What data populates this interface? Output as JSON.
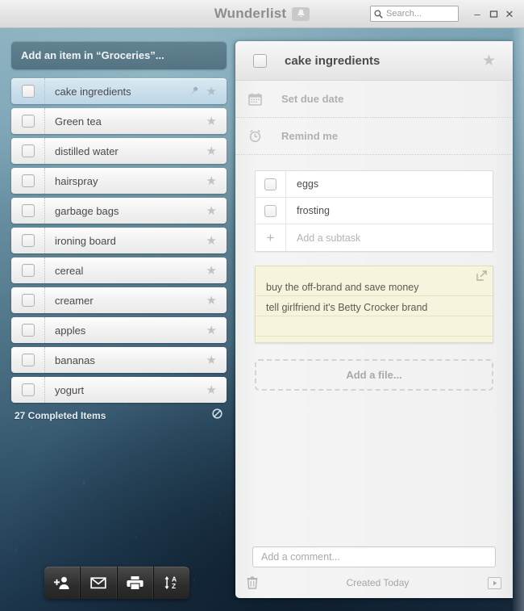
{
  "titlebar": {
    "app_title": "Wunderlist",
    "bell_icon": "bell-icon",
    "search": {
      "placeholder": "Search...",
      "value": "Search...",
      "icon": "search-icon"
    },
    "window_controls": {
      "minimize": "–",
      "maximize": "❐",
      "close": "✕"
    }
  },
  "list_panel": {
    "add_item_placeholder": "Add an item in “Groceries”...",
    "list_name": "Groceries",
    "tasks": [
      {
        "title": "cake ingredients",
        "selected": true,
        "starred": false,
        "pinned": true,
        "checked": false
      },
      {
        "title": "Green tea",
        "selected": false,
        "starred": false,
        "pinned": false,
        "checked": false
      },
      {
        "title": "distilled water",
        "selected": false,
        "starred": false,
        "pinned": false,
        "checked": false
      },
      {
        "title": "hairspray",
        "selected": false,
        "starred": false,
        "pinned": false,
        "checked": false
      },
      {
        "title": "garbage bags",
        "selected": false,
        "starred": false,
        "pinned": false,
        "checked": false
      },
      {
        "title": "ironing board",
        "selected": false,
        "starred": false,
        "pinned": false,
        "checked": false
      },
      {
        "title": "cereal",
        "selected": false,
        "starred": false,
        "pinned": false,
        "checked": false
      },
      {
        "title": "creamer",
        "selected": false,
        "starred": false,
        "pinned": false,
        "checked": false
      },
      {
        "title": "apples",
        "selected": false,
        "starred": false,
        "pinned": false,
        "checked": false
      },
      {
        "title": "bananas",
        "selected": false,
        "starred": false,
        "pinned": false,
        "checked": false
      },
      {
        "title": "yogurt",
        "selected": false,
        "starred": false,
        "pinned": false,
        "checked": false
      }
    ],
    "completed_label": "27 Completed Items",
    "completed_count": 27,
    "toggle_completed_icon": "hide-eye-slash-icon"
  },
  "bottom_toolbar": {
    "buttons": [
      {
        "name": "share-add-person-button",
        "icon": "add-person-icon"
      },
      {
        "name": "email-list-button",
        "icon": "envelope-icon"
      },
      {
        "name": "print-list-button",
        "icon": "printer-icon"
      },
      {
        "name": "sort-list-button",
        "icon": "sort-alpha-icon"
      }
    ]
  },
  "detail": {
    "title": "cake ingredients",
    "checked": false,
    "starred": false,
    "star_icon": "star-icon",
    "due_date": {
      "label": "Set due date",
      "icon": "calendar-icon"
    },
    "reminder": {
      "label": "Remind me",
      "icon": "alarm-clock-icon"
    },
    "subtasks": [
      {
        "title": "eggs",
        "checked": false
      },
      {
        "title": "frosting",
        "checked": false
      }
    ],
    "add_subtask_placeholder": "Add a subtask",
    "add_subtask_icon": "plus-icon",
    "notes": {
      "lines": [
        "buy the off-brand and save money",
        "tell girlfriend it's Betty Crocker brand"
      ],
      "expand_icon": "expand-external-icon",
      "background_color": "#f7f4dd"
    },
    "add_file_label": "Add a file...",
    "comment_placeholder": "Add a comment...",
    "footer": {
      "delete_icon": "trash-icon",
      "created_label": "Created Today",
      "activity_icon": "play-icon"
    }
  },
  "theme": {
    "accent_selected_row": "#cbdfec",
    "background_top": "#8fb4c2",
    "background_bottom": "#16283b",
    "toolbar_dark": "#2d2d2d",
    "note_paper": "#f7f4dd"
  }
}
